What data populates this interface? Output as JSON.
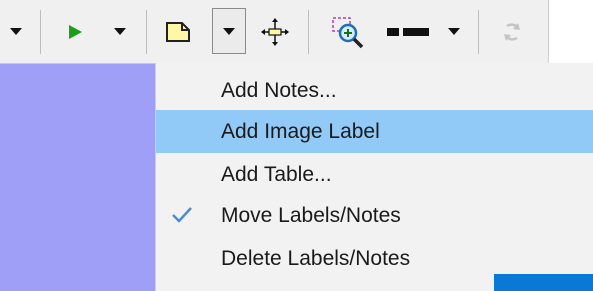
{
  "toolbar": {
    "icons": [
      "caret-down-icon",
      "play-icon",
      "note-icon",
      "move-icon",
      "zoom-icon",
      "line-style-icon",
      "refresh-icon"
    ]
  },
  "menu": {
    "items": [
      {
        "label": "Add Notes...",
        "highlighted": false,
        "checked": false
      },
      {
        "label": "Add Image Label",
        "highlighted": true,
        "checked": false
      },
      {
        "label": "Add Table...",
        "highlighted": false,
        "checked": false
      },
      {
        "label": "Move Labels/Notes",
        "highlighted": false,
        "checked": true
      },
      {
        "label": "Delete Labels/Notes",
        "highlighted": false,
        "checked": false
      }
    ]
  },
  "colors": {
    "highlight": "#91c9f7",
    "canvas": "#9f9ff8",
    "accent": "#0a78d7",
    "play_green": "#19a019"
  }
}
